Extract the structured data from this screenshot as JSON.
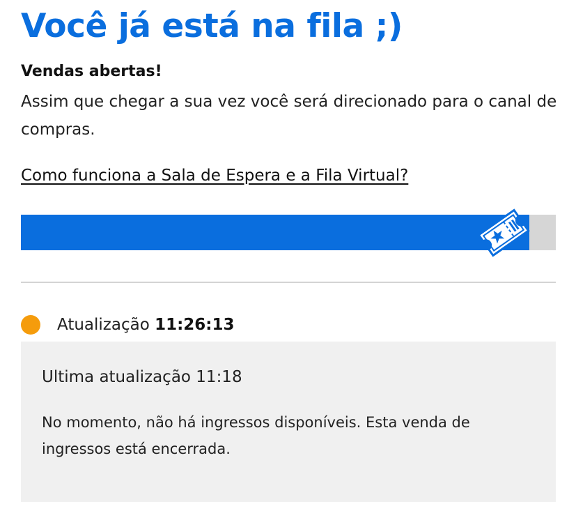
{
  "header": {
    "title": "Você já está na fila ;)"
  },
  "sale": {
    "status": "Vendas abertas!",
    "description": "Assim que chegar a sua vez você será direcionado para o canal de compras."
  },
  "help": {
    "link_text": "Como funciona a Sala de Espera e a Fila Virtual?"
  },
  "queue": {
    "progress_fraction": 0.95,
    "icon": "ticket-icon"
  },
  "update": {
    "label": "Atualização",
    "time": "11:26:13",
    "indicator_color": "#f59c0c",
    "indicator_icon": "status-dot"
  },
  "message": {
    "last_update": "Ultima atualização 11:18",
    "text": "No momento, não há ingressos disponíveis. Esta venda de ingressos está encerrada."
  },
  "colors": {
    "accent": "#0a6ede",
    "track": "#d6d6d6",
    "panel": "#f0f0f0"
  }
}
